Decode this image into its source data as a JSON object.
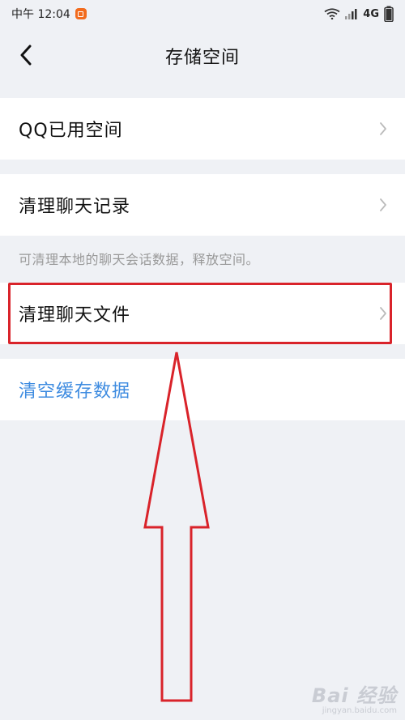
{
  "status_bar": {
    "time": "中午 12:04",
    "network": "4G"
  },
  "nav": {
    "title": "存储空间"
  },
  "cells": {
    "qq_used_space": "QQ已用空间",
    "clear_chat_history": "清理聊天记录",
    "clear_chat_history_hint": "可清理本地的聊天会话数据，释放空间。",
    "clear_chat_files": "清理聊天文件",
    "clear_cache": "清空缓存数据"
  },
  "watermark": {
    "logo": "Bai 经验",
    "sub": "jingyan.baidu.com"
  },
  "colors": {
    "background": "#eff1f5",
    "cell_background": "#ffffff",
    "link_blue": "#3d8be0",
    "annotation_red": "#d9232a",
    "hint_gray": "#999999"
  }
}
